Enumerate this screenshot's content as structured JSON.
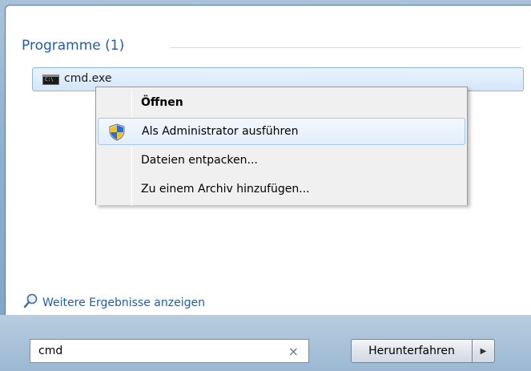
{
  "results": {
    "section_title": "Programme (1)",
    "items": [
      {
        "label": "cmd.exe",
        "icon": "command-prompt-icon"
      }
    ]
  },
  "context_menu": {
    "items": [
      {
        "label": "Öffnen",
        "bold": true
      },
      {
        "label": "Als Administrator ausführen",
        "icon": "uac-shield-icon",
        "highlighted": true
      },
      {
        "label": "Dateien entpacken..."
      },
      {
        "label": "Zu einem Archiv hinzufügen..."
      }
    ]
  },
  "more_results_label": "Weitere Ergebnisse anzeigen",
  "search": {
    "value": "cmd",
    "clear_glyph": "×"
  },
  "shutdown": {
    "label": "Herunterfahren",
    "arrow_glyph": "▶"
  },
  "colors": {
    "accent_text": "#1e5dac",
    "hover_border": "#a8c8ec",
    "selection_border": "#8eb6e0"
  }
}
